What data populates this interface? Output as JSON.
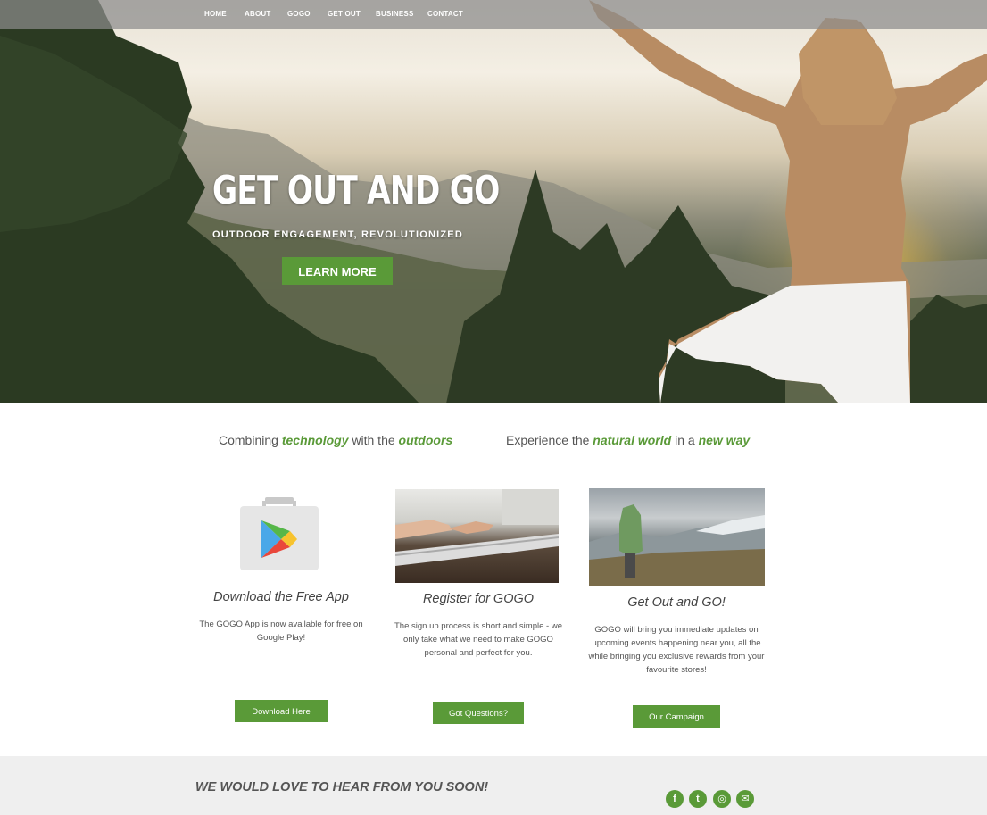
{
  "nav": {
    "items": [
      {
        "label": "HOME"
      },
      {
        "label": "ABOUT"
      },
      {
        "label": "GOGO"
      },
      {
        "label": "GET OUT"
      },
      {
        "label": "BUSINESS"
      },
      {
        "label": "CONTACT"
      }
    ]
  },
  "hero": {
    "title": "GET OUT AND GO",
    "subtitle": "OUTDOOR ENGAGEMENT, REVOLUTIONIZED",
    "button": "LEARN MORE"
  },
  "taglines": {
    "left": {
      "p1": "Combining ",
      "e1": "technology",
      "p2": " with the ",
      "e2": "outdoors"
    },
    "right": {
      "p1": "Experience the ",
      "e1": "natural world",
      "p2": " in a ",
      "e2": "new way"
    }
  },
  "features": [
    {
      "title": "Download the Free App",
      "text": "The GOGO App is now available for free on Google Play!",
      "button": "Download Here",
      "icon": "google-play-icon"
    },
    {
      "title": "Register for GOGO",
      "text": "The sign up process is short and simple - we only take what we need to make GOGO personal and perfect for you.",
      "button": "Got Questions?"
    },
    {
      "title": "Get Out and GO!",
      "text": "GOGO will bring you immediate updates on upcoming events happening near you, all the while bringing you exclusive rewards from your favourite stores!",
      "button": "Our Campaign"
    }
  ],
  "footer": {
    "title": "WE WOULD LOVE TO HEAR FROM YOU SOON!",
    "social": [
      {
        "icon": "facebook-icon",
        "glyph": "f"
      },
      {
        "icon": "twitter-icon",
        "glyph": "t"
      },
      {
        "icon": "instagram-icon",
        "glyph": "◎"
      },
      {
        "icon": "email-icon",
        "glyph": "✉"
      }
    ]
  },
  "colors": {
    "accent": "#5a9a38",
    "nav_bg": "#8c8c8c",
    "footer_bg": "#efefef"
  }
}
